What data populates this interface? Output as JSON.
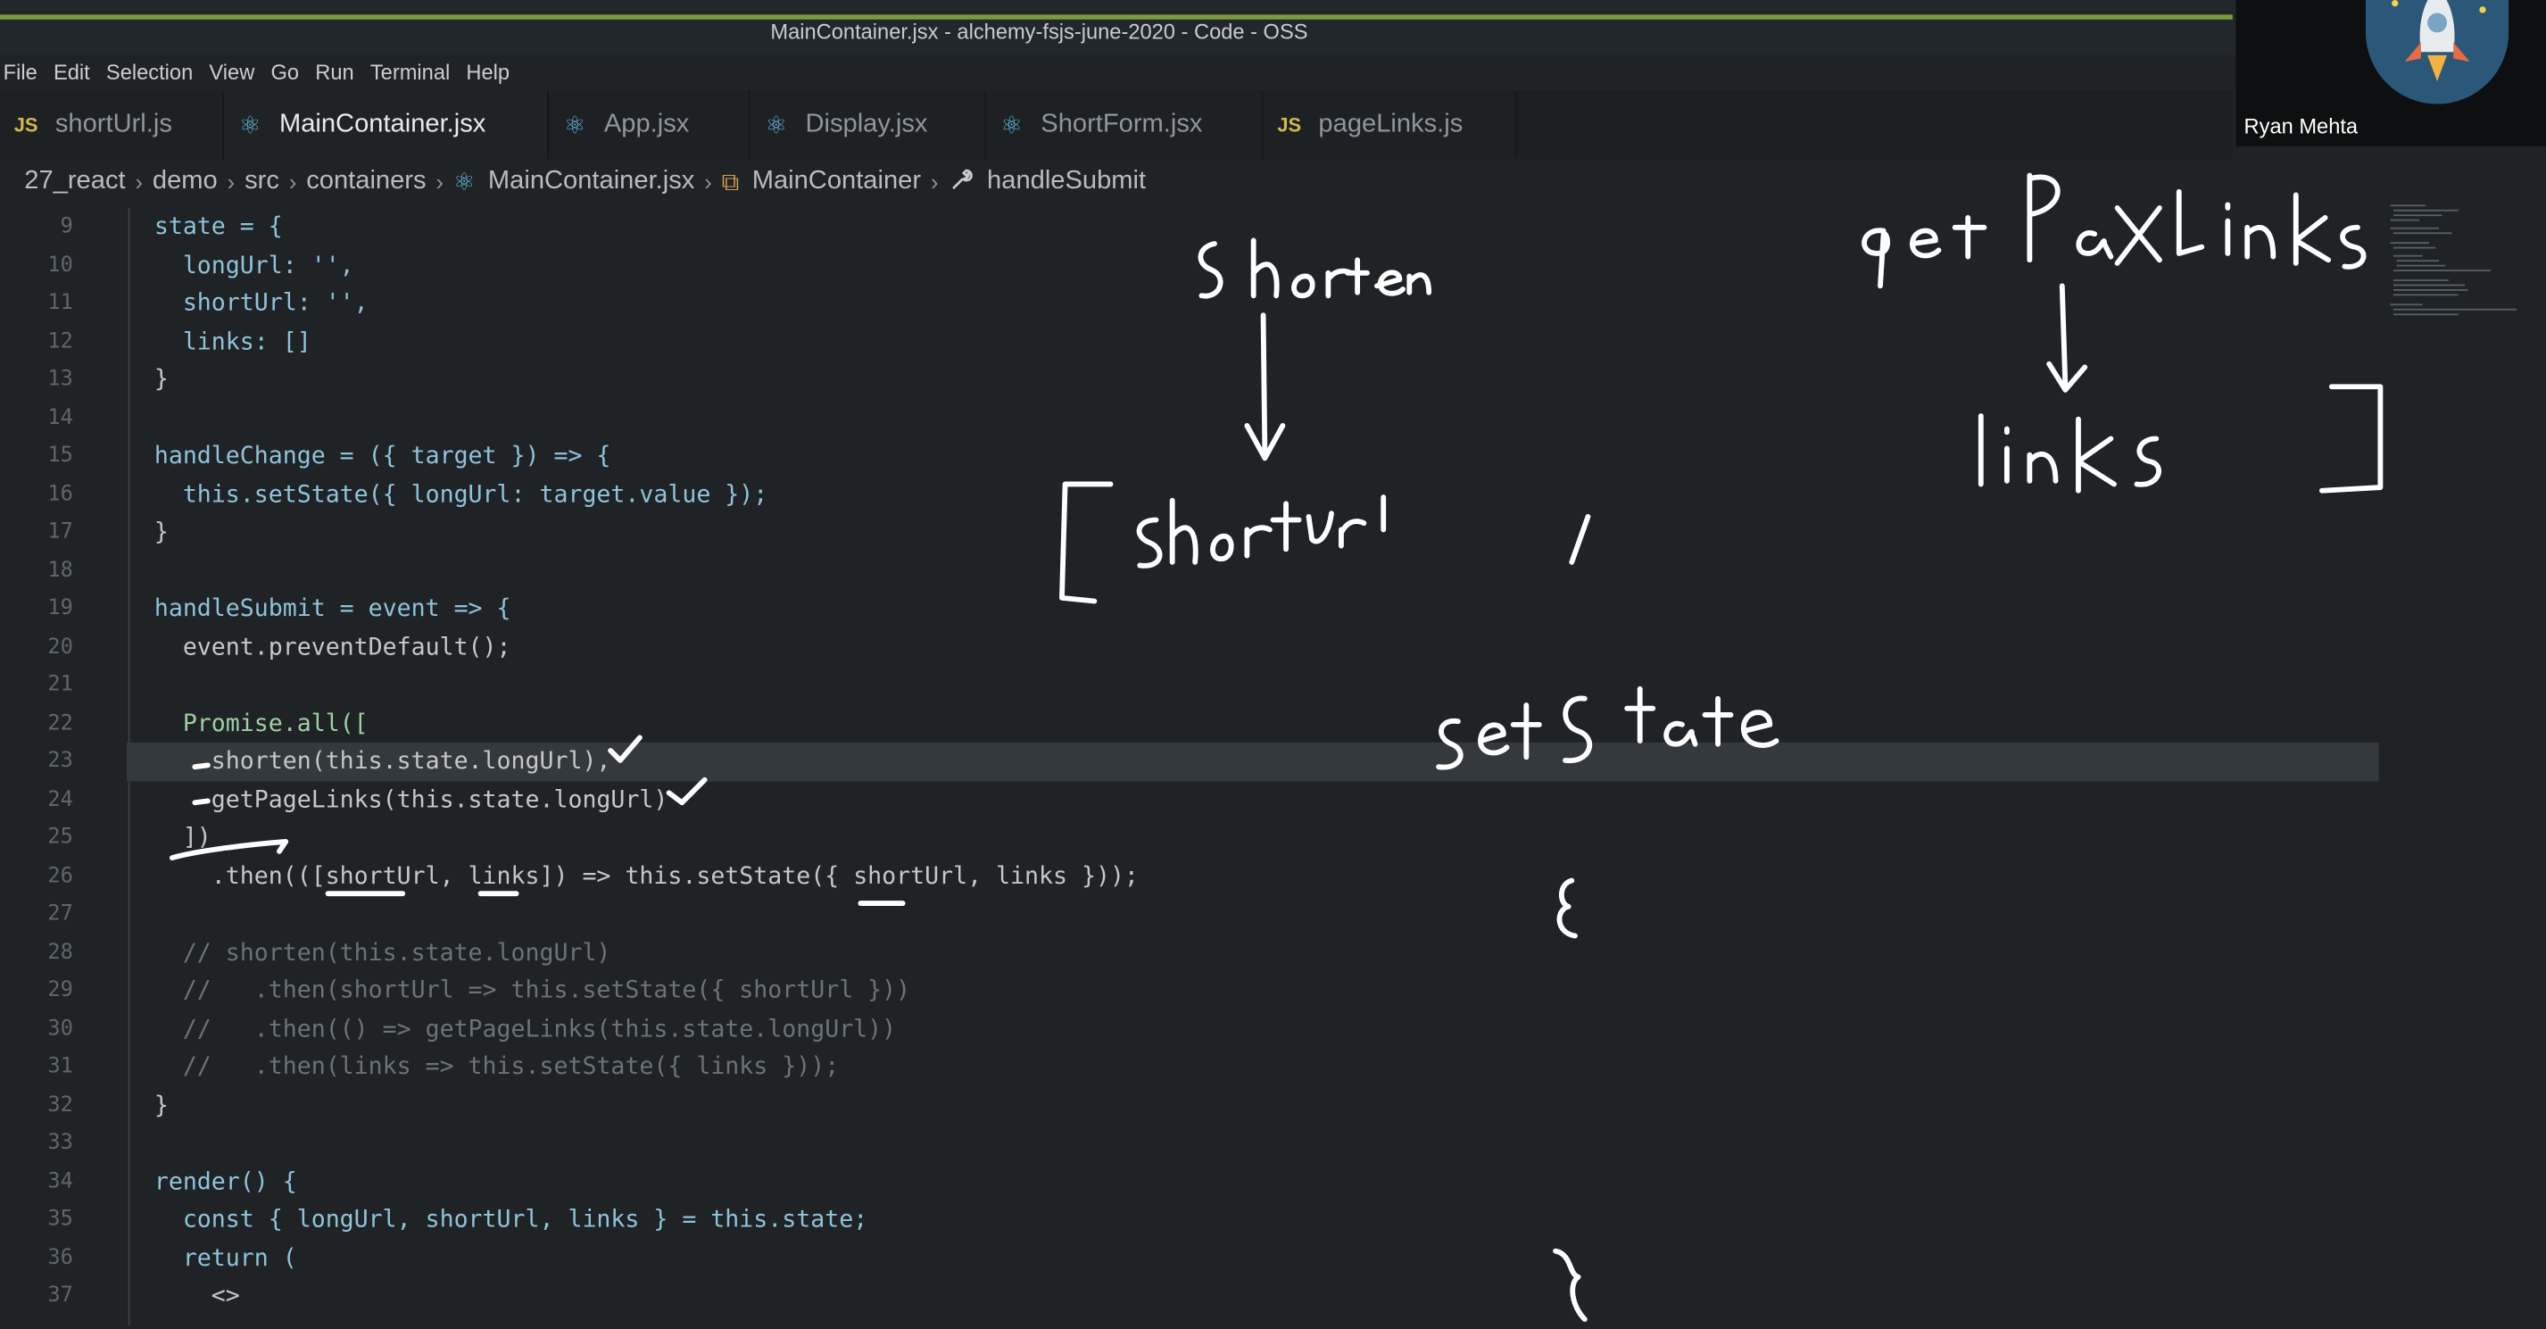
{
  "window": {
    "title": "MainContainer.jsx - alchemy-fsjs-june-2020 - Code - OSS"
  },
  "menu": [
    "File",
    "Edit",
    "Selection",
    "View",
    "Go",
    "Run",
    "Terminal",
    "Help"
  ],
  "tabs": [
    {
      "label": "shortUrl.js",
      "icon": "js-file-icon",
      "badge": "JS"
    },
    {
      "label": "MainContainer.jsx",
      "icon": "react-file-icon",
      "badge": "⚛"
    },
    {
      "label": "App.jsx",
      "icon": "react-file-icon",
      "badge": "⚛"
    },
    {
      "label": "Display.jsx",
      "icon": "react-file-icon",
      "badge": "⚛"
    },
    {
      "label": "ShortForm.jsx",
      "icon": "react-file-icon",
      "badge": "⚛"
    },
    {
      "label": "pageLinks.js",
      "icon": "js-file-icon",
      "badge": "JS"
    }
  ],
  "active_tab": "MainContainer.jsx",
  "breadcrumb": [
    "27_react",
    "demo",
    "src",
    "containers",
    "MainContainer.jsx",
    "MainContainer",
    "handleSubmit"
  ],
  "breadcrumb_sep": "›",
  "participant": "Ryan Mehta",
  "lines": [
    {
      "n": "9",
      "text": "state = {"
    },
    {
      "n": "10",
      "text": "  longUrl: '',"
    },
    {
      "n": "11",
      "text": "  shortUrl: '',"
    },
    {
      "n": "12",
      "text": "  links: []"
    },
    {
      "n": "13",
      "text": "}"
    },
    {
      "n": "14",
      "text": ""
    },
    {
      "n": "15",
      "text": "handleChange = ({ target }) => {"
    },
    {
      "n": "16",
      "text": "  this.setState({ longUrl: target.value });"
    },
    {
      "n": "17",
      "text": "}"
    },
    {
      "n": "18",
      "text": ""
    },
    {
      "n": "19",
      "text": "handleSubmit = event => {"
    },
    {
      "n": "20",
      "text": "  event.preventDefault();"
    },
    {
      "n": "21",
      "text": ""
    },
    {
      "n": "22",
      "text": "  Promise.all(["
    },
    {
      "n": "23",
      "text": "    shorten(this.state.longUrl),"
    },
    {
      "n": "24",
      "text": "    getPageLinks(this.state.longUrl)"
    },
    {
      "n": "25",
      "text": "  ])"
    },
    {
      "n": "26",
      "text": "    .then(([shortUrl, links]) => this.setState({ shortUrl, links }));"
    },
    {
      "n": "27",
      "text": ""
    },
    {
      "n": "28",
      "text": "  // shorten(this.state.longUrl)"
    },
    {
      "n": "29",
      "text": "  //   .then(shortUrl => this.setState({ shortUrl }))"
    },
    {
      "n": "30",
      "text": "  //   .then(() => getPageLinks(this.state.longUrl))"
    },
    {
      "n": "31",
      "text": "  //   .then(links => this.setState({ links }));"
    },
    {
      "n": "32",
      "text": "}"
    },
    {
      "n": "33",
      "text": ""
    },
    {
      "n": "34",
      "text": "render() {"
    },
    {
      "n": "35",
      "text": "  const { longUrl, shortUrl, links } = this.state;"
    },
    {
      "n": "36",
      "text": "  return ("
    },
    {
      "n": "37",
      "text": "    <>"
    }
  ],
  "highlighted_line": "23",
  "colors": {
    "background": "#1f2326",
    "keyword": "#5aa1d8",
    "property": "#8fc3d9",
    "string": "#b5b48a",
    "comment": "#6b7378",
    "class": "#9ccfa2",
    "title_accent": "#7a9b3a"
  }
}
